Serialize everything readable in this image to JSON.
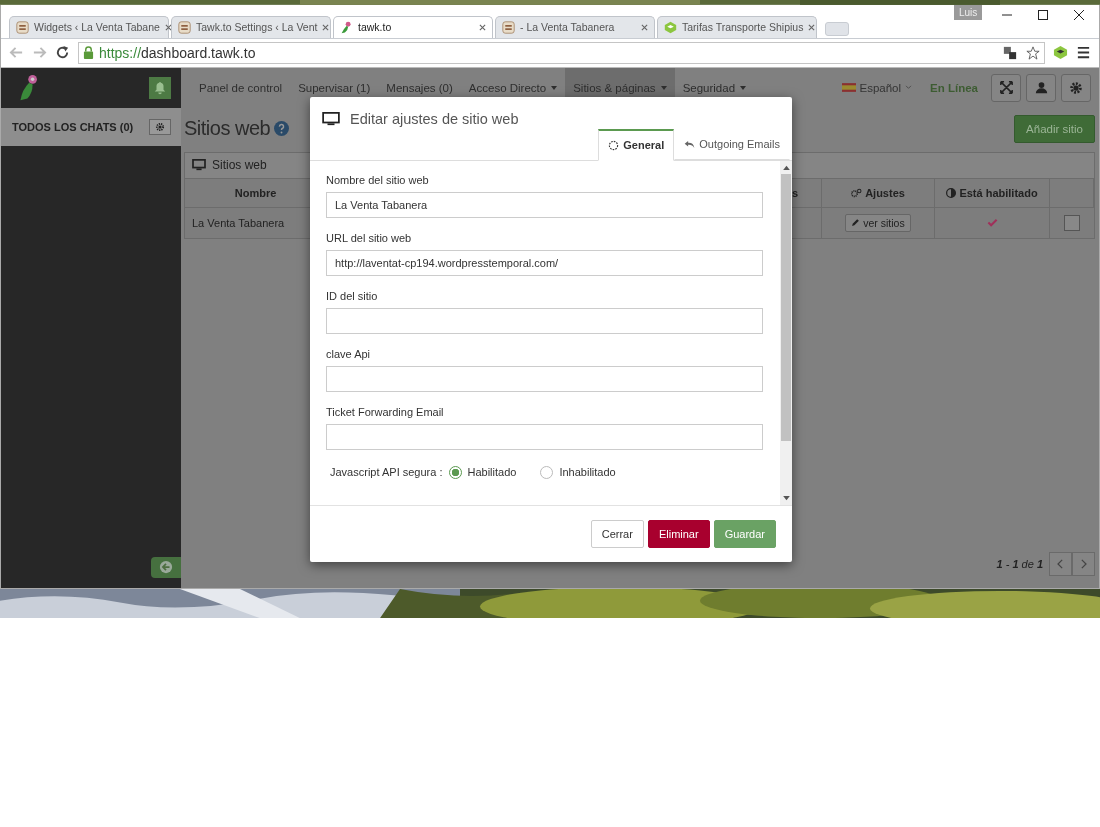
{
  "browser": {
    "tabs": [
      {
        "title": "Widgets ‹ La Venta Tabane",
        "kind": "store",
        "selected": false
      },
      {
        "title": "Tawk.to Settings ‹ La Vent",
        "kind": "store",
        "selected": false
      },
      {
        "title": "tawk.to",
        "kind": "parrot",
        "selected": true
      },
      {
        "title": "- La Venta Tabanera",
        "kind": "store",
        "selected": false
      },
      {
        "title": "Tarifas Transporte Shipius",
        "kind": "cube",
        "selected": false
      }
    ],
    "user": "Luis",
    "address": {
      "scheme": "https://",
      "host": "dashboard.tawk.to"
    }
  },
  "sidebar": {
    "header": "TODOS LOS CHATS (0)"
  },
  "nav": {
    "items": [
      {
        "label": "Panel de control",
        "selected": false,
        "dropdown": false
      },
      {
        "label": "Supervisar (1)",
        "selected": false,
        "dropdown": false
      },
      {
        "label": "Mensajes (0)",
        "selected": false,
        "dropdown": false
      },
      {
        "label": "Acceso Directo",
        "selected": false,
        "dropdown": true
      },
      {
        "label": "Sitios & páginas",
        "selected": true,
        "dropdown": true
      },
      {
        "label": "Seguridad",
        "selected": false,
        "dropdown": true
      }
    ],
    "language": "Español",
    "status": "En Línea"
  },
  "page": {
    "title": "Sitios web",
    "add_button": "Añadir sitio",
    "panel_title": "Sitios web",
    "columns": [
      "Nombre",
      "s",
      "Ajustes",
      "Está habilitado"
    ],
    "rows": [
      {
        "name": "La Venta Tabanera",
        "action": "ver sitios",
        "enabled": true,
        "checked": false
      }
    ],
    "pagination": "**1** - **1** de **1**"
  },
  "modal": {
    "title": "Editar ajustes de sitio web",
    "tabs": [
      {
        "label": "General",
        "kind": "gear",
        "selected": true
      },
      {
        "label": "Outgoing Emails",
        "kind": "reply",
        "selected": false
      }
    ],
    "fields": [
      {
        "label": "Nombre del sitio web",
        "value": "La Venta Tabanera"
      },
      {
        "label": "URL del sitio web",
        "value": "http://laventat-cp194.wordpresstemporal.com/"
      },
      {
        "label": "ID del sitio"
      },
      {
        "label": "clave Api"
      },
      {
        "label": "Ticket Forwarding Email"
      }
    ],
    "secure_api": {
      "label": "Javascript API segura :",
      "options": [
        {
          "label": "Habilitado",
          "selected": true
        },
        {
          "label": "Inhabilitado",
          "selected": false
        }
      ]
    },
    "buttons": [
      {
        "label": "Cerrar",
        "kind": "default"
      },
      {
        "label": "Eliminar",
        "kind": "danger"
      },
      {
        "label": "Guardar",
        "kind": "primary"
      }
    ]
  }
}
